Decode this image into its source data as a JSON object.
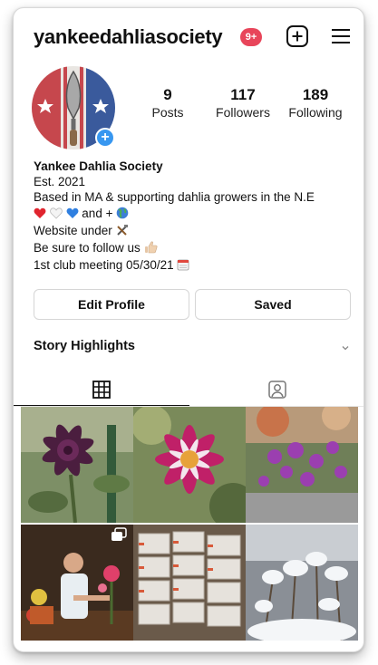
{
  "header": {
    "username": "yankeedahliasociety",
    "notification_badge": "9+",
    "new_post_icon": "plus-square-icon",
    "menu_icon": "hamburger-menu-icon"
  },
  "profile": {
    "avatar_icon": "avatar-trowel-flag-icon",
    "stats": [
      {
        "count": "9",
        "label": "Posts"
      },
      {
        "count": "117",
        "label": "Followers"
      },
      {
        "count": "189",
        "label": "Following"
      }
    ]
  },
  "bio": {
    "name": "Yankee Dahlia Society",
    "line1": "Est. 2021",
    "line2": "Based in MA & supporting dahlia growers in the N.E",
    "line3_text": "and +",
    "line4": "Website under",
    "line5": "Be sure to follow us",
    "line6": "1st club meeting 05/30/21"
  },
  "buttons": {
    "edit_profile": "Edit Profile",
    "saved": "Saved"
  },
  "story_highlights": {
    "label": "Story Highlights"
  },
  "tabs": [
    {
      "name": "grid",
      "icon": "grid-icon",
      "active": true
    },
    {
      "name": "tagged",
      "icon": "tagged-person-icon",
      "active": false
    }
  ],
  "posts": [
    {
      "subject": "dark purple dahlia"
    },
    {
      "subject": "magenta and white dahlia"
    },
    {
      "subject": "purple dahlias in garden"
    },
    {
      "subject": "man holding dahlias",
      "multi": true
    },
    {
      "subject": "stacked storage containers"
    },
    {
      "subject": "snowy plants"
    }
  ],
  "colors": {
    "badge": "#e8455a",
    "accent_blue": "#3897f0"
  }
}
